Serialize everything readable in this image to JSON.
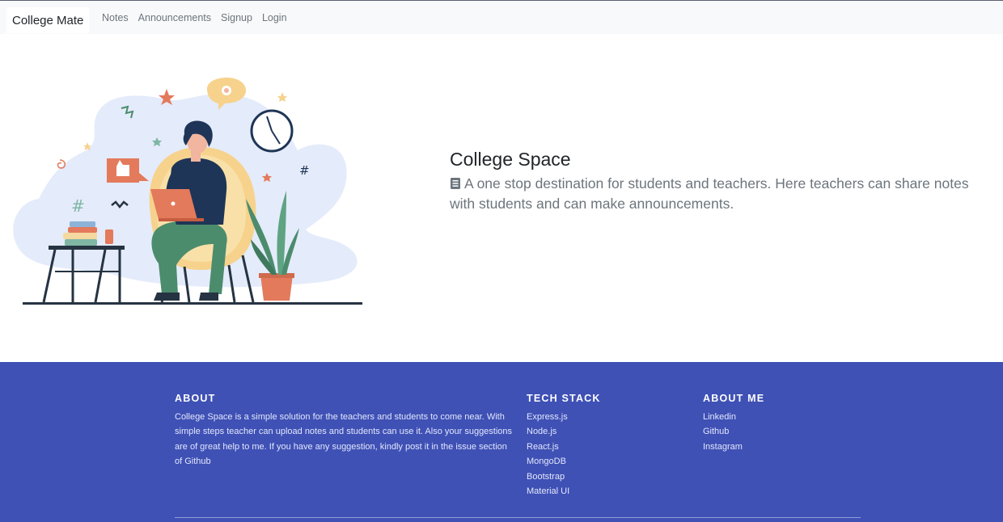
{
  "navbar": {
    "brand": "College Mate",
    "links": [
      "Notes",
      "Announcements",
      "Signup",
      "Login"
    ]
  },
  "hero": {
    "title": "College Space",
    "icon": "document-icon",
    "description": "A one stop destination for students and teachers. Here teachers can share notes with students and can make announcements."
  },
  "footer": {
    "about": {
      "title": "ABOUT",
      "text": "College Space is a simple solution for the teachers and students to come near. With simple steps teacher can upload notes and students can use it. Also your suggestions are of great help to me. If you have any suggestion, kindly post it in the issue section of Github"
    },
    "tech_stack": {
      "title": "TECH STACK",
      "items": [
        "Express.js",
        "Node.js",
        "React.js",
        "MongoDB",
        "Bootstrap",
        "Material UI"
      ]
    },
    "about_me": {
      "title": "ABOUT ME",
      "items": [
        "Linkedin",
        "Github",
        "Instagram"
      ]
    }
  },
  "colors": {
    "navbar_bg": "#f8f9fa",
    "footer_bg": "#3f51b5",
    "title_text": "#212529",
    "muted_text": "#6c757d"
  }
}
